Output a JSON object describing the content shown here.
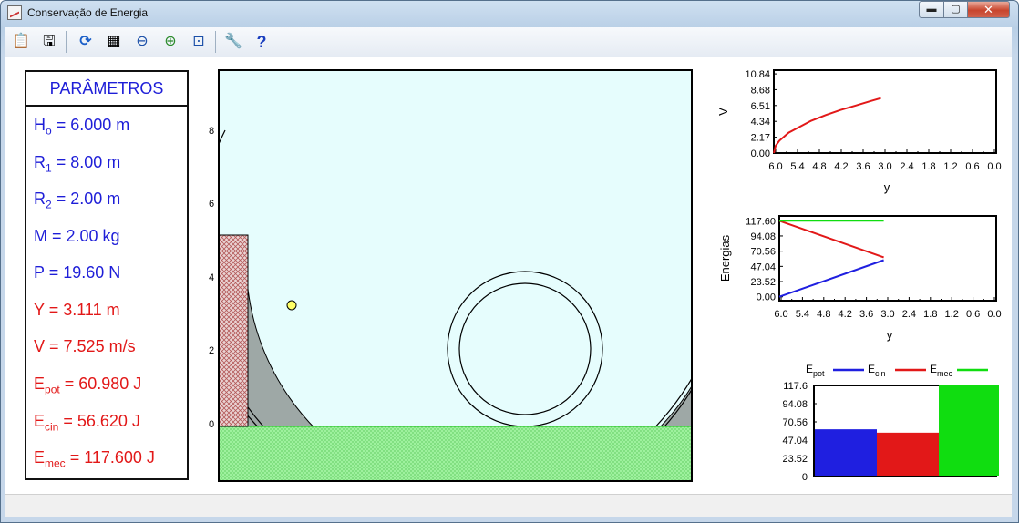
{
  "window": {
    "title": "Conservação de Energia",
    "buttons": {
      "minimize": "▬",
      "maximize": "▢",
      "close": "✕"
    }
  },
  "toolbar": {
    "items": [
      {
        "name": "copy-icon",
        "glyph": "📋"
      },
      {
        "name": "export-icon",
        "glyph": "🖫"
      },
      {
        "name": "refresh-icon",
        "glyph": "⟳"
      },
      {
        "name": "grid-icon",
        "glyph": "▦"
      },
      {
        "name": "zoom-out-icon",
        "glyph": "⊖"
      },
      {
        "name": "zoom-in-icon",
        "glyph": "⊕"
      },
      {
        "name": "zoom-fit-icon",
        "glyph": "⊡"
      },
      {
        "name": "wrench-icon",
        "glyph": "🔧"
      },
      {
        "name": "help-icon",
        "glyph": "?"
      }
    ]
  },
  "params": {
    "title": "PARÂMETROS",
    "rows": [
      {
        "sym": "H",
        "sub": "o",
        "val": " = 6.000 m",
        "color": "#1e1ed8"
      },
      {
        "sym": "R",
        "sub": "1",
        "val": " = 8.00 m",
        "color": "#1e1ed8"
      },
      {
        "sym": "R",
        "sub": "2",
        "val": " = 2.00 m",
        "color": "#1e1ed8"
      },
      {
        "sym": "M",
        "sub": "",
        "val": " = 2.00 kg",
        "color": "#1e1ed8"
      },
      {
        "sym": "P",
        "sub": "",
        "val": " = 19.60 N",
        "color": "#1e1ed8"
      },
      {
        "sym": "Y",
        "sub": "",
        "val": " = 3.111 m",
        "color": "#e21818"
      },
      {
        "sym": "V",
        "sub": "",
        "val": " = 7.525 m/s",
        "color": "#e21818"
      },
      {
        "sym": "E",
        "sub": "pot",
        "val": " = 60.980 J",
        "color": "#e21818"
      },
      {
        "sym": "E",
        "sub": "cin",
        "val": " = 56.620 J",
        "color": "#e21818"
      },
      {
        "sym": "E",
        "sub": "mec",
        "val": " = 117.600 J",
        "color": "#e21818"
      }
    ]
  },
  "simulation": {
    "y_ticks": [
      "8",
      "6",
      "4",
      "2",
      "0"
    ],
    "colors": {
      "sky": "#e6fdfd",
      "ground": "#9ea8a6",
      "grass": "#a2f4a2",
      "tower": "#ead4d4"
    }
  },
  "chart_data": [
    {
      "type": "line",
      "ylabel": "V",
      "xlabel": "y",
      "x_ticks": [
        "6.0",
        "5.4",
        "4.8",
        "4.2",
        "3.6",
        "3.0",
        "2.4",
        "1.8",
        "1.2",
        "0.6",
        "0.0"
      ],
      "y_ticks": [
        "10.84",
        "8.68",
        "6.51",
        "4.34",
        "2.17",
        "0.00"
      ],
      "xlim": [
        6.0,
        0.0
      ],
      "ylim": [
        0,
        11.35
      ],
      "series": [
        {
          "color": "#e21818",
          "x": [
            6.0,
            5.95,
            5.85,
            5.6,
            5.3,
            5.0,
            4.6,
            4.2,
            3.8,
            3.4,
            3.111
          ],
          "y": [
            0.0,
            1.0,
            1.7,
            2.8,
            3.6,
            4.4,
            5.2,
            5.9,
            6.5,
            7.1,
            7.525
          ]
        }
      ]
    },
    {
      "type": "line",
      "ylabel": "Energias",
      "xlabel": "y",
      "x_ticks": [
        "6.0",
        "5.4",
        "4.8",
        "4.2",
        "3.6",
        "3.0",
        "2.4",
        "1.8",
        "1.2",
        "0.6",
        "0.0"
      ],
      "y_ticks": [
        "117.60",
        "94.08",
        "70.56",
        "47.04",
        "23.52",
        "0.00"
      ],
      "xlim": [
        6.0,
        0.0
      ],
      "ylim": [
        -6,
        125
      ],
      "series": [
        {
          "color": "#e21818",
          "x": [
            6.0,
            3.111
          ],
          "y": [
            117.6,
            60.98
          ]
        },
        {
          "color": "#1f1fe0",
          "x": [
            6.0,
            3.111
          ],
          "y": [
            0.0,
            56.62
          ]
        },
        {
          "color": "#10dd10",
          "x": [
            6.0,
            3.111
          ],
          "y": [
            117.6,
            117.6
          ]
        }
      ]
    },
    {
      "type": "bar",
      "legend": [
        {
          "sym": "E",
          "sub": "pot",
          "color": "#1f1fe0"
        },
        {
          "sym": "E",
          "sub": "cin",
          "color": "#e21818"
        },
        {
          "sym": "E",
          "sub": "mec",
          "color": "#10dd10"
        }
      ],
      "y_ticks": [
        "117.6",
        "94.08",
        "70.56",
        "47.04",
        "23.52",
        "0"
      ],
      "ylim": [
        0,
        117.6
      ],
      "values": [
        60.98,
        56.62,
        117.6
      ]
    }
  ]
}
